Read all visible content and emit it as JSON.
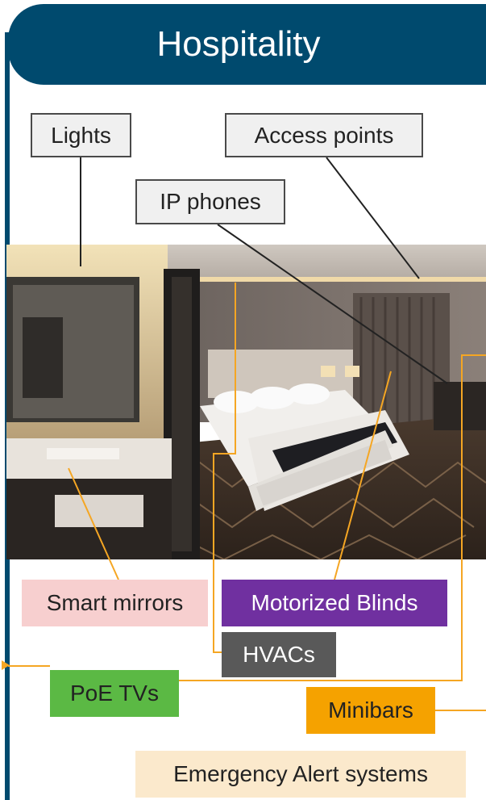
{
  "header": {
    "title": "Hospitality"
  },
  "callouts": {
    "lights": "Lights",
    "access_points": "Access points",
    "ip_phones": "IP phones"
  },
  "tags": {
    "smart_mirrors": "Smart mirrors",
    "motorized_blinds": "Motorized Blinds",
    "hvacs": "HVACs",
    "poe_tvs": "PoE TVs",
    "minibars": "Minibars",
    "emergency_alert": "Emergency Alert systems"
  },
  "colors": {
    "header_bg": "#004a6e",
    "smart_mirrors_bg": "#f7cfcf",
    "motorized_blinds_bg": "#7030a0",
    "hvacs_bg": "#595959",
    "poe_tvs_bg": "#5bb944",
    "minibars_bg": "#f5a200",
    "emergency_alert_bg": "#fbe9cc",
    "leader_orange": "#f5a623",
    "leader_dark": "#222222"
  },
  "photo": {
    "subject": "hotel-room-image"
  }
}
